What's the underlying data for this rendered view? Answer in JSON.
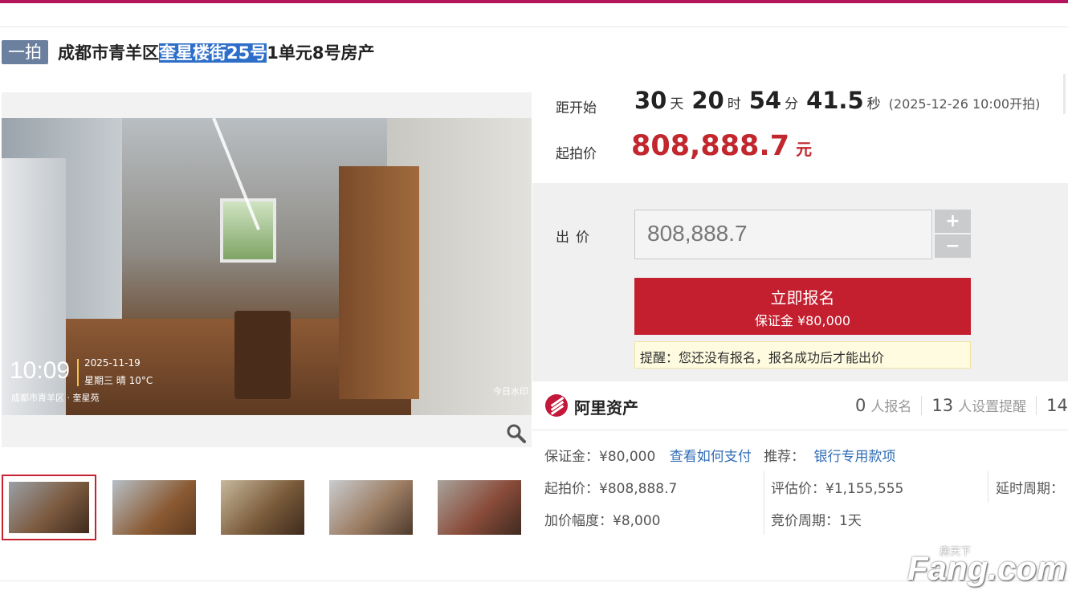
{
  "header": {
    "round_tag": "一拍",
    "title_prefix": "成都市青羊区",
    "title_highlight": "奎星楼街25号",
    "title_suffix": "1单元8号房产"
  },
  "gallery": {
    "watermark": {
      "time": "10:09",
      "date": "2025-11-19",
      "weekday_weather": "星期三 晴 10°C",
      "location": "成都市青羊区 · 奎星苑",
      "brand": "今日水印"
    },
    "zoom_icon": "magnifier-icon",
    "thumbnail_count": 5,
    "active_thumbnail": 1
  },
  "countdown": {
    "label": "距开始",
    "days": "30",
    "days_unit": "天",
    "hours": "20",
    "hours_unit": "时",
    "minutes": "54",
    "minutes_unit": "分",
    "seconds": "41.5",
    "seconds_unit": "秒",
    "start_note": "(2025-12-26 10:00开拍)"
  },
  "starting_price": {
    "label": "起拍价",
    "value": "808,888.7",
    "unit": "元"
  },
  "bid": {
    "label": "出价",
    "input_value": "808,888.7",
    "plus": "+",
    "minus": "−",
    "signup_button": "立即报名",
    "deposit_note": "保证金 ¥80,000",
    "reminder": "提醒：您还没有报名，报名成功后才能出价"
  },
  "platform": {
    "name": "阿里资产",
    "registered_count": "0",
    "registered_label": "人报名",
    "reminder_count": "13",
    "reminder_label": "人设置提醒",
    "viewer_count_partial": "14"
  },
  "details": {
    "deposit": "保证金：¥80,000",
    "how_to_pay": "查看如何支付",
    "recommend_label": "推荐：",
    "recommend_link": "银行专用款项",
    "start_price": "起拍价：¥808,888.7",
    "appraisal": "评估价：¥1,155,555",
    "delay_period": "延时周期：",
    "increment": "加价幅度：¥8,000",
    "bid_period": "竞价周期：1天"
  },
  "watermark_site": {
    "cn": "房天下",
    "en": "Fang.com"
  },
  "colors": {
    "brand_bar": "#b3165a",
    "price_red": "#c1272d",
    "button_red": "#c41f2f",
    "tag_blue": "#6b7f9e",
    "link_blue": "#2f6db5"
  }
}
